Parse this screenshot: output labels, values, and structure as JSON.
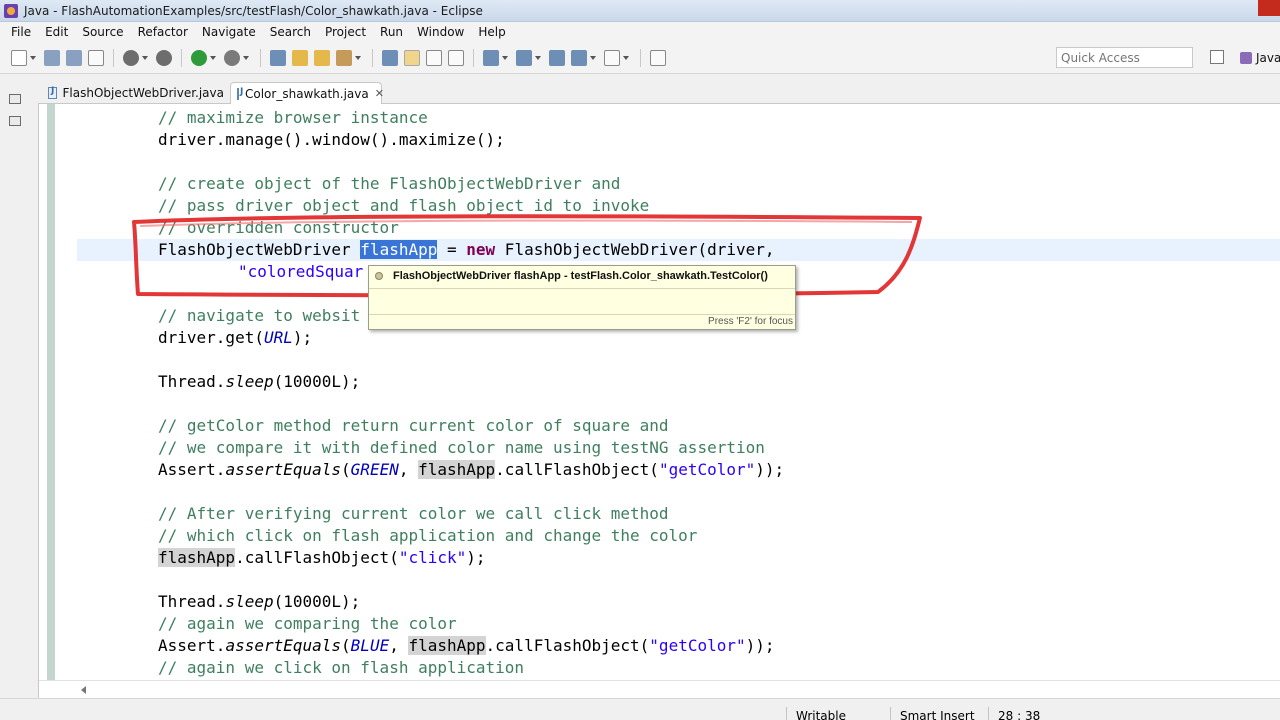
{
  "window": {
    "title": "Java - FlashAutomationExamples/src/testFlash/Color_shawkath.java - Eclipse"
  },
  "menubar": {
    "items": [
      "File",
      "Edit",
      "Source",
      "Refactor",
      "Navigate",
      "Search",
      "Project",
      "Run",
      "Window",
      "Help"
    ]
  },
  "toolbar": {
    "quick_access_placeholder": "Quick Access",
    "perspective_label": "Java"
  },
  "tabs": [
    {
      "label": "FlashObjectWebDriver.java",
      "active": false
    },
    {
      "label": "Color_shawkath.java",
      "active": true,
      "close": "✕"
    }
  ],
  "code": {
    "l1": "// maximize browser instance",
    "l2": "driver.manage().window().maximize();",
    "l3": "// create object of the FlashObjectWebDriver and",
    "l4": "// pass driver object and flash object id to invoke",
    "l5": "// overridden constructor",
    "l6_type": "FlashObjectWebDriver ",
    "l6_var": "flashApp",
    "l6_eq": " = ",
    "l6_new": "new",
    "l6_rest": " FlashObjectWebDriver(driver,",
    "l7": "\"coloredSquar",
    "l8": "// navigate to websit",
    "l9_a": "driver.get(",
    "l9_url": "URL",
    "l9_b": ");",
    "l10_a": "Thread.",
    "l10_m": "sleep",
    "l10_b": "(10000L);",
    "l11": "// getColor method return current color of square and",
    "l12": "// we compare it with defined color name using testNG assertion",
    "l13_a": "Assert.",
    "l13_m": "assertEquals",
    "l13_b": "(",
    "l13_c": "GREEN",
    "l13_d": ", ",
    "l13_var": "flashApp",
    "l13_e": ".callFlashObject(",
    "l13_s": "\"getColor\"",
    "l13_f": "));",
    "l14": "// After verifying current color we call click method",
    "l15": "// which click on flash application and change the color",
    "l16_var": "flashApp",
    "l16_a": ".callFlashObject(",
    "l16_s": "\"click\"",
    "l16_b": ");",
    "l17_a": "Thread.",
    "l17_m": "sleep",
    "l17_b": "(10000L);",
    "l18": "// again we comparing the color",
    "l19_a": "Assert.",
    "l19_m": "assertEquals",
    "l19_b": "(",
    "l19_c": "BLUE",
    "l19_d": ", ",
    "l19_var": "flashApp",
    "l19_e": ".callFlashObject(",
    "l19_s": "\"getColor\"",
    "l19_f": "));",
    "l20": "// again we click on flash application"
  },
  "hover": {
    "signature": "FlashObjectWebDriver flashApp - testFlash.Color_shawkath.TestColor()",
    "footer": "Press 'F2' for focus"
  },
  "statusbar": {
    "mode": "Writable",
    "insert": "Smart Insert",
    "position": "28 : 38"
  },
  "colors": {
    "comment": "#3f7f5f",
    "keyword": "#7f0055",
    "string": "#2a00ff",
    "field": "#0000c0",
    "selection": "#3875d7",
    "annotation": "#e02020"
  }
}
